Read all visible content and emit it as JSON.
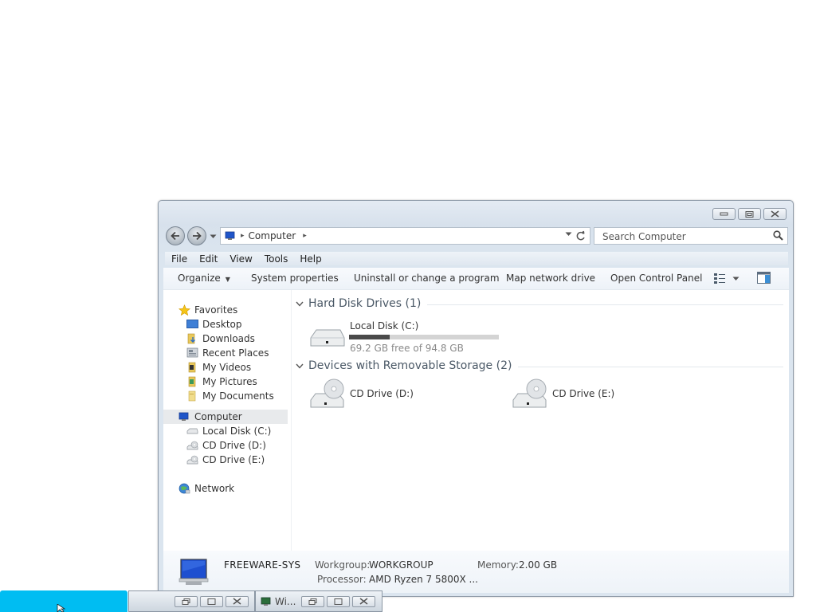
{
  "window": {
    "address": {
      "location": "Computer"
    },
    "search": {
      "placeholder": "Search Computer"
    },
    "menu": [
      "File",
      "Edit",
      "View",
      "Tools",
      "Help"
    ],
    "toolbar": {
      "organize": "Organize",
      "system_properties": "System properties",
      "uninstall": "Uninstall or change a program",
      "map_drive": "Map network drive",
      "control_panel": "Open Control Panel"
    },
    "navpane": {
      "favorites": "Favorites",
      "favorites_items": [
        "Desktop",
        "Downloads",
        "Recent Places",
        "My Videos",
        "My Pictures",
        "My Documents"
      ],
      "computer": "Computer",
      "computer_items": [
        "Local Disk (C:)",
        "CD Drive (D:)",
        "CD Drive (E:)"
      ],
      "network": "Network"
    },
    "groups": {
      "hard_disks": "Hard Disk Drives (1)",
      "removable": "Devices with Removable Storage (2)"
    },
    "drives": {
      "c": {
        "name": "Local Disk (C:)",
        "free_text": "69.2 GB free of 94.8 GB",
        "used_fraction": 0.27
      },
      "d": {
        "name": "CD Drive (D:)"
      },
      "e": {
        "name": "CD Drive (E:)"
      }
    },
    "details": {
      "computer_name": "FREEWARE-SYS",
      "workgroup_label": "Workgroup:",
      "workgroup": "WORKGROUP",
      "memory_label": "Memory:",
      "memory": "2.00 GB",
      "processor_label": "Processor:",
      "processor": "AMD Ryzen 7 5800X ..."
    }
  },
  "taskbar": {
    "window_title": "Wi..."
  },
  "colors": {
    "start_button": "#00bdf2",
    "chrome_top": "#e4ebf3",
    "selection": "#e8eaec"
  }
}
